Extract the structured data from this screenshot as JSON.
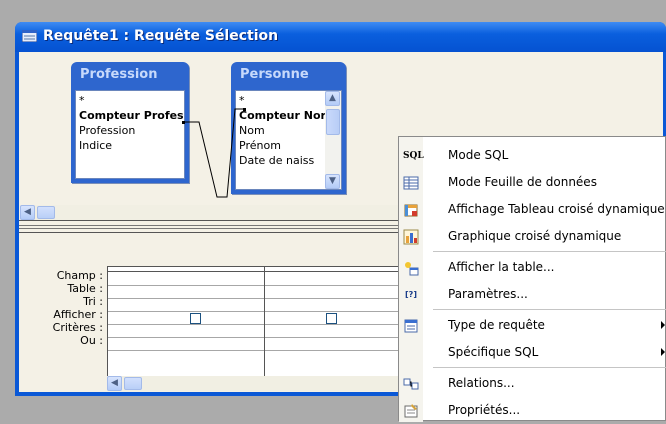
{
  "window": {
    "title": "Requête1 : Requête Sélection"
  },
  "tables": [
    {
      "name": "Profession",
      "fields": [
        "*",
        "Compteur Profes",
        "Profession",
        "Indice"
      ]
    },
    {
      "name": "Personne",
      "fields": [
        "*",
        "Compteur Nor",
        "Nom",
        "Prénom",
        "Date de naiss"
      ]
    }
  ],
  "grid": {
    "row_labels": [
      "Champ :",
      "Table :",
      "Tri :",
      "Afficher :",
      "Critères :",
      "Ou :"
    ]
  },
  "context_menu": {
    "items": [
      {
        "label": "Mode SQL",
        "icon": "sql-icon",
        "icon_text": "SQL"
      },
      {
        "label": "Mode Feuille de données",
        "icon": "datasheet-icon"
      },
      {
        "label": "Affichage Tableau croisé dynamique",
        "icon": "pivot-table-icon"
      },
      {
        "label": "Graphique croisé dynamique",
        "icon": "pivot-chart-icon"
      },
      {
        "label": "Afficher la table...",
        "icon": "show-table-icon"
      },
      {
        "label": "Paramètres...",
        "icon": "parameters-icon",
        "icon_text": "[?]"
      },
      {
        "label": "Type de requête",
        "icon": "query-type-icon",
        "submenu": true
      },
      {
        "label": "Spécifique SQL",
        "submenu": true
      },
      {
        "label": "Relations...",
        "icon": "relationships-icon"
      },
      {
        "label": "Propriétés...",
        "icon": "properties-icon"
      }
    ]
  },
  "colors": {
    "titlebar": "#0a58d6",
    "table_header": "#2e66ce",
    "background": "#f4f1e6"
  }
}
